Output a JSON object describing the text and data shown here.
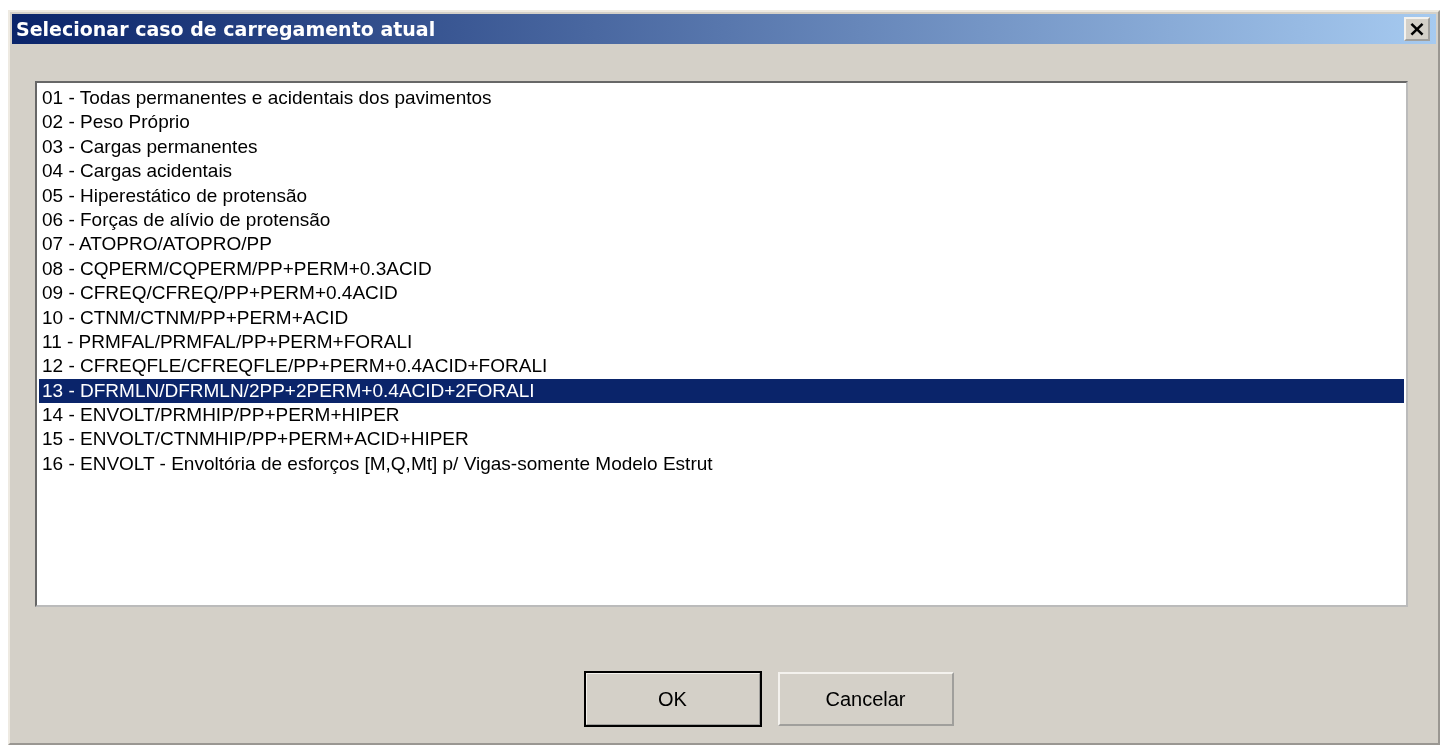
{
  "window": {
    "title": "Selecionar caso de carregamento atual",
    "close": "×"
  },
  "list": {
    "items": [
      {
        "label": "01 - Todas permanentes e acidentais dos pavimentos",
        "selected": false
      },
      {
        "label": "02 - Peso Próprio",
        "selected": false
      },
      {
        "label": "03 - Cargas permanentes",
        "selected": false
      },
      {
        "label": "04 - Cargas acidentais",
        "selected": false
      },
      {
        "label": "05 - Hiperestático de protensão",
        "selected": false
      },
      {
        "label": "06 - Forças de alívio de protensão",
        "selected": false
      },
      {
        "label": "07 - ATOPRO/ATOPRO/PP",
        "selected": false
      },
      {
        "label": "08 - CQPERM/CQPERM/PP+PERM+0.3ACID",
        "selected": false
      },
      {
        "label": "09 - CFREQ/CFREQ/PP+PERM+0.4ACID",
        "selected": false
      },
      {
        "label": "10 - CTNM/CTNM/PP+PERM+ACID",
        "selected": false
      },
      {
        "label": "11 - PRMFAL/PRMFAL/PP+PERM+FORALI",
        "selected": false
      },
      {
        "label": "12 - CFREQFLE/CFREQFLE/PP+PERM+0.4ACID+FORALI",
        "selected": false
      },
      {
        "label": "13 - DFRMLN/DFRMLN/2PP+2PERM+0.4ACID+2FORALI",
        "selected": true
      },
      {
        "label": "14 - ENVOLT/PRMHIP/PP+PERM+HIPER",
        "selected": false
      },
      {
        "label": "15 - ENVOLT/CTNMHIP/PP+PERM+ACID+HIPER",
        "selected": false
      },
      {
        "label": "16 - ENVOLT - Envoltória de esforços [M,Q,Mt] p/ Vigas-somente Modelo Estrut",
        "selected": false
      }
    ]
  },
  "buttons": [
    {
      "label": "OK",
      "default": true
    },
    {
      "label": "Cancelar",
      "default": false
    }
  ]
}
